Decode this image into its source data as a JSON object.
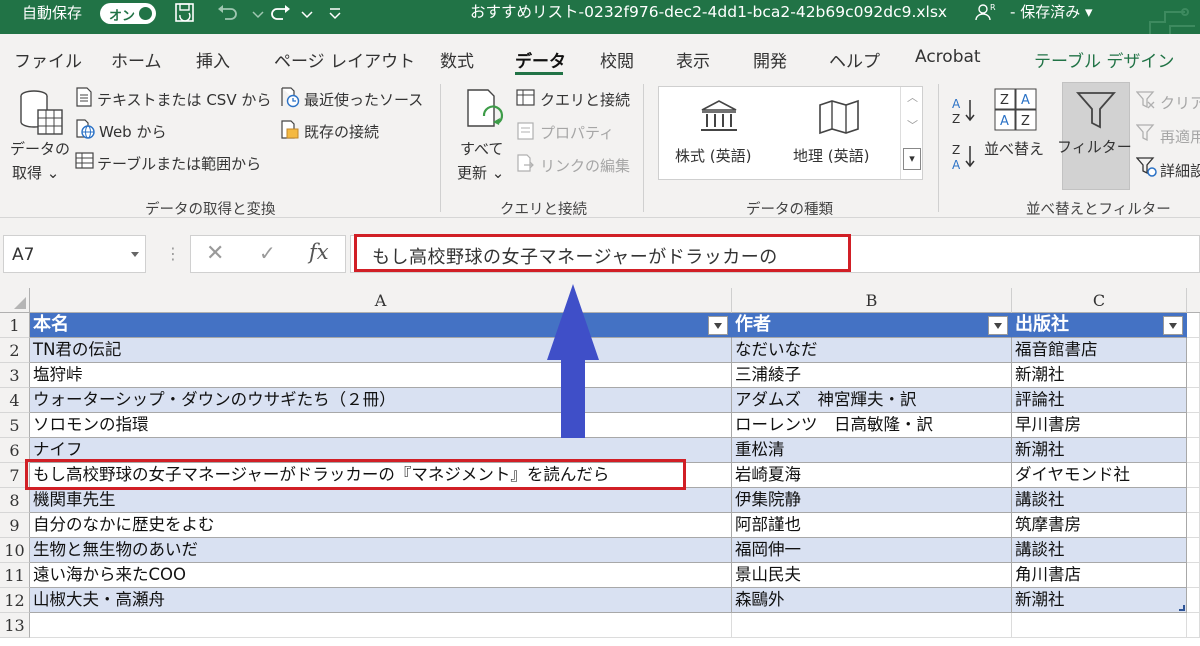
{
  "titlebar": {
    "autosave_label": "自動保存",
    "autosave_toggle": "オン",
    "filename": "おすすめリスト-0232f976-dec2-4dd1-bca2-42b69c092dc9.xlsx",
    "save_status": "保存済み"
  },
  "menu": {
    "tabs": [
      "ファイル",
      "ホーム",
      "挿入",
      "ページ レイアウト",
      "数式",
      "データ",
      "校閲",
      "表示",
      "開発",
      "ヘルプ",
      "Acrobat",
      "テーブル デザイン"
    ],
    "active_tab": "データ"
  },
  "ribbon": {
    "get_data": {
      "button_line1": "データの",
      "button_line2": "取得",
      "from_text_csv": "テキストまたは CSV から",
      "from_web": "Web から",
      "from_table_range": "テーブルまたは範囲から",
      "recent_sources": "最近使ったソース",
      "existing_connections": "既存の接続",
      "group_label": "データの取得と変換"
    },
    "queries": {
      "refresh_line1": "すべて",
      "refresh_line2": "更新",
      "queries_connections": "クエリと接続",
      "properties": "プロパティ",
      "edit_links": "リンクの編集",
      "group_label": "クエリと接続"
    },
    "data_types": {
      "stocks": "株式 (英語)",
      "geography": "地理 (英語)",
      "group_label": "データの種類"
    },
    "sort_filter": {
      "sort": "並べ替え",
      "filter": "フィルター",
      "clear": "クリア",
      "reapply": "再適用",
      "advanced": "詳細設",
      "group_label": "並べ替えとフィルター"
    }
  },
  "formula_bar": {
    "name_box": "A7",
    "fx_label": "fx",
    "formula_text": "もし高校野球の女子マネージャーがドラッカーの"
  },
  "grid": {
    "columns": [
      "A",
      "B",
      "C"
    ],
    "row_numbers": [
      "1",
      "2",
      "3",
      "4",
      "5",
      "6",
      "7",
      "8",
      "9",
      "10",
      "11",
      "12",
      "13"
    ],
    "headers": [
      "本名",
      "作者",
      "出版社"
    ],
    "rows": [
      [
        "TN君の伝記",
        "なだいなだ",
        "福音館書店"
      ],
      [
        "塩狩峠",
        "三浦綾子",
        "新潮社"
      ],
      [
        "ウォーターシップ・ダウンのウサギたち（２冊）",
        "アダムズ　神宮輝夫・訳",
        "評論社"
      ],
      [
        "ソロモンの指環",
        "ローレンツ　日高敏隆・訳",
        "早川書房"
      ],
      [
        "ナイフ",
        "重松清",
        "新潮社"
      ],
      [
        "もし高校野球の女子マネージャーがドラッカーの『マネジメント』を読んだら",
        "岩崎夏海",
        "ダイヤモンド社"
      ],
      [
        "機関車先生",
        "伊集院静",
        "講談社"
      ],
      [
        "自分のなかに歴史をよむ",
        "阿部謹也",
        "筑摩書房"
      ],
      [
        "生物と無生物のあいだ",
        "福岡伸一",
        "講談社"
      ],
      [
        "遠い海から来たCOO",
        "景山民夫",
        "角川書店"
      ],
      [
        "山椒大夫・高瀬舟",
        "森鷗外",
        "新潮社"
      ]
    ]
  },
  "colors": {
    "titlebar": "#217346",
    "table_header": "#4472c4",
    "table_band": "#d9e1f2",
    "highlight_box": "#d11f26",
    "arrow": "#3f4fc8"
  }
}
